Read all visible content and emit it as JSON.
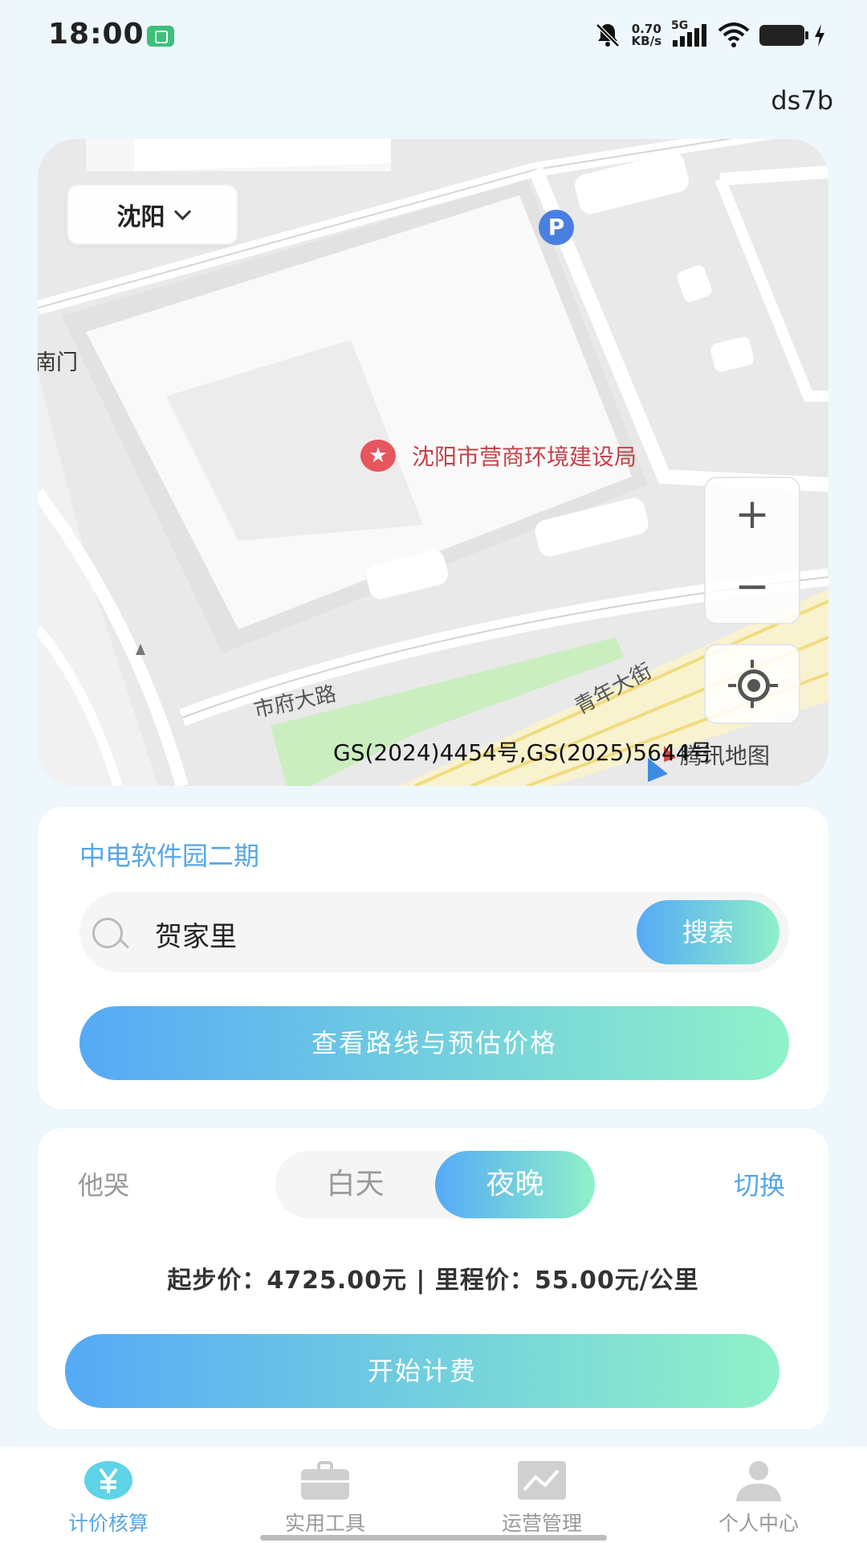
{
  "status_bar": {
    "time": "18:00",
    "net_speed_value": "0.70",
    "net_speed_unit": "KB/s",
    "network": "5G"
  },
  "device_id": "ds7b",
  "map": {
    "city": "沈阳",
    "poi_name": "沈阳市营商环境建设局",
    "poi_star": "★",
    "parking": "P",
    "left_edge_label": "南门",
    "road1": "市府大路",
    "road2": "青年大街",
    "copyright": "GS(2024)4454号,GS(2025)5644号",
    "provider": "腾讯地图",
    "zoom_in": "+",
    "zoom_out": "−"
  },
  "route_card": {
    "location_title": "中电软件园二期",
    "search_value": "贺家里",
    "search_button": "搜索",
    "route_button": "查看路线与预估价格"
  },
  "pricing_card": {
    "car_type": "他哭",
    "toggle_day": "白天",
    "toggle_night": "夜晚",
    "switch_label": "切换",
    "price_line": "起步价：4725.00元 | 里程价：55.00元/公里",
    "start_button": "开始计费"
  },
  "tabbar": {
    "items": [
      {
        "label": "计价核算",
        "icon": "yen-icon",
        "active": true
      },
      {
        "label": "实用工具",
        "icon": "briefcase-icon",
        "active": false
      },
      {
        "label": "运营管理",
        "icon": "chart-icon",
        "active": false
      },
      {
        "label": "个人中心",
        "icon": "person-icon",
        "active": false
      }
    ]
  },
  "colors": {
    "accent_blue": "#58a6e6",
    "gradient_start": "#55aaf6",
    "gradient_end": "#8ff2c8"
  }
}
